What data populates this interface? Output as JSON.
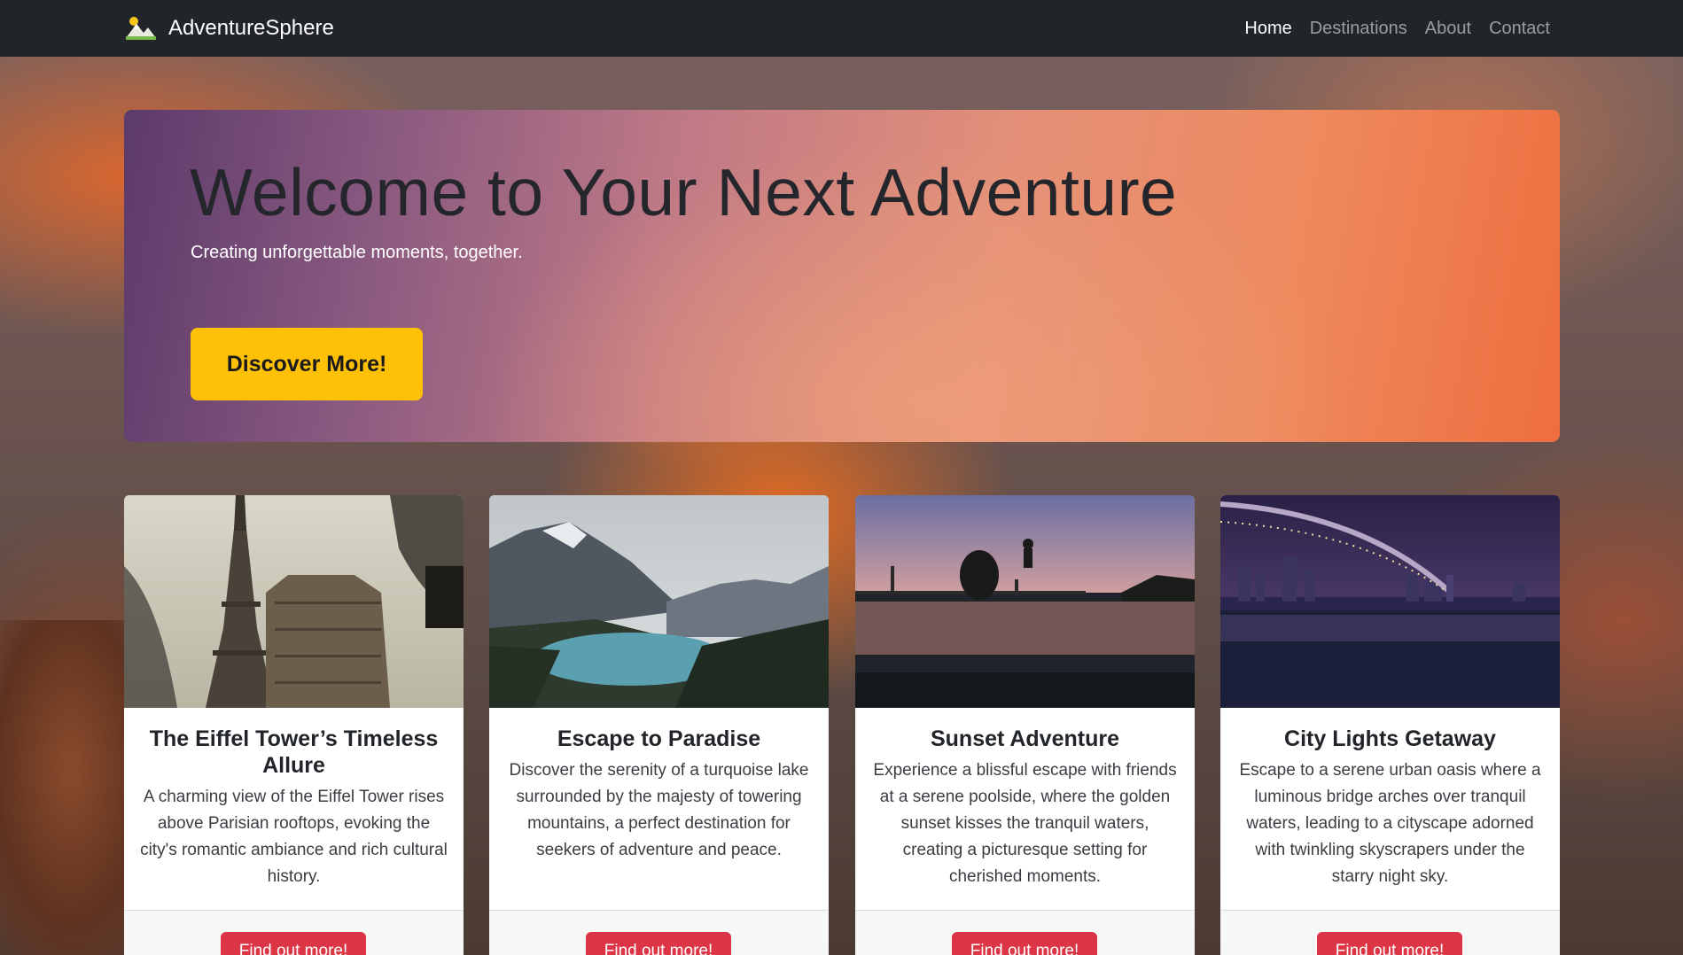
{
  "navbar": {
    "brand": "AdventureSphere",
    "logo_icon": "mountain-sun-icon",
    "links": [
      {
        "label": "Home",
        "active": true
      },
      {
        "label": "Destinations",
        "active": false
      },
      {
        "label": "About",
        "active": false
      },
      {
        "label": "Contact",
        "active": false
      }
    ]
  },
  "hero": {
    "title": "Welcome to Your Next Adventure",
    "subtitle": "Creating unforgettable moments, together.",
    "button_label": "Discover More!"
  },
  "cards": [
    {
      "title": "The Eiffel Tower’s Timeless Allure",
      "text": "A charming view of the Eiffel Tower rises above Parisian rooftops, evoking the city's romantic ambiance and rich cultural history.",
      "button_label": "Find out more!",
      "image": "eiffel-tower-photo"
    },
    {
      "title": "Escape to Paradise",
      "text": "Discover the serenity of a turquoise lake surrounded by the majesty of towering mountains, a perfect destination for seekers of adventure and peace.",
      "button_label": "Find out more!",
      "image": "mountain-lake-photo"
    },
    {
      "title": "Sunset Adventure",
      "text": "Experience a blissful escape with friends at a serene poolside, where the golden sunset kisses the tranquil waters, creating a picturesque setting for cherished moments.",
      "button_label": "Find out more!",
      "image": "sunset-pool-photo"
    },
    {
      "title": "City Lights Getaway",
      "text": "Escape to a serene urban oasis where a luminous bridge arches over tranquil waters, leading to a cityscape adorned with twinkling skyscrapers under the starry night sky.",
      "button_label": "Find out more!",
      "image": "city-bridge-night-photo"
    }
  ],
  "colors": {
    "navbar_bg": "#212529",
    "hero_button": "#ffc107",
    "card_button": "#dc3545"
  }
}
